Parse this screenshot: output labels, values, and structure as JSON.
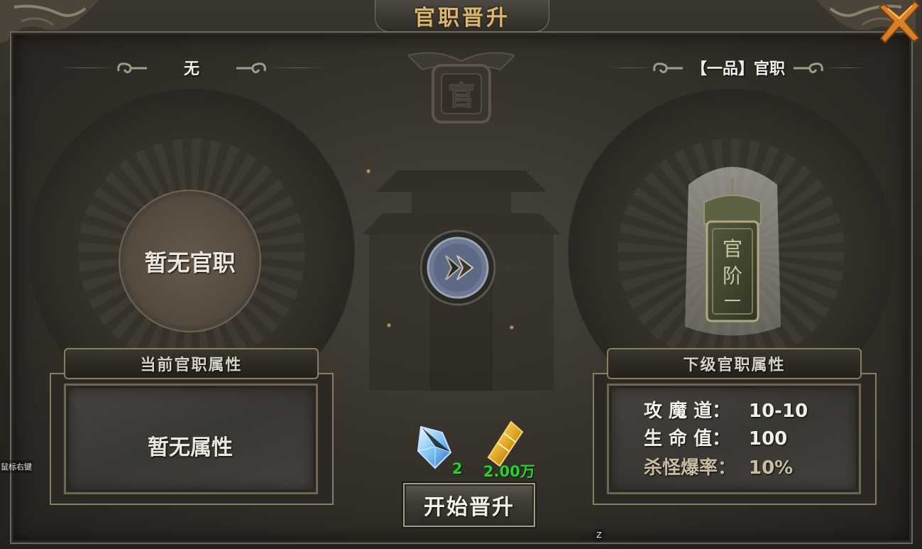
{
  "window": {
    "title": "官职晋升",
    "close_icon": "close-x-icon"
  },
  "current": {
    "rank_label": "无",
    "rank_display": "暂无官职",
    "attr_title": "当前官职属性",
    "attr_empty": "暂无属性"
  },
  "next": {
    "rank_label": "【一品】官职",
    "token_icon": "official-rank-token-icon",
    "attr_title": "下级官职属性",
    "attributes": [
      {
        "name": "攻 魔 道：",
        "value": "10-10",
        "color": "#f2efe7"
      },
      {
        "name": "生 命 值：",
        "value": "100",
        "color": "#f2efe7"
      },
      {
        "name": "杀怪爆率：",
        "value": "10%",
        "color": "#c8bca3"
      }
    ]
  },
  "costs": {
    "gem_icon": "blue-crystal-icon",
    "gem_amount": "2",
    "gold_icon": "gold-ingot-icon",
    "gold_amount": "2.00万",
    "amount_color": "#27d22b"
  },
  "actions": {
    "arrow_icon": "advance-arrow-icon",
    "promote_label": "开始晋升"
  },
  "hints": {
    "mouse_hint": "鼠标右键",
    "key_hint": "Z"
  },
  "colors": {
    "title_gold": "#d9b870",
    "frame_border": "#8a7c61"
  }
}
